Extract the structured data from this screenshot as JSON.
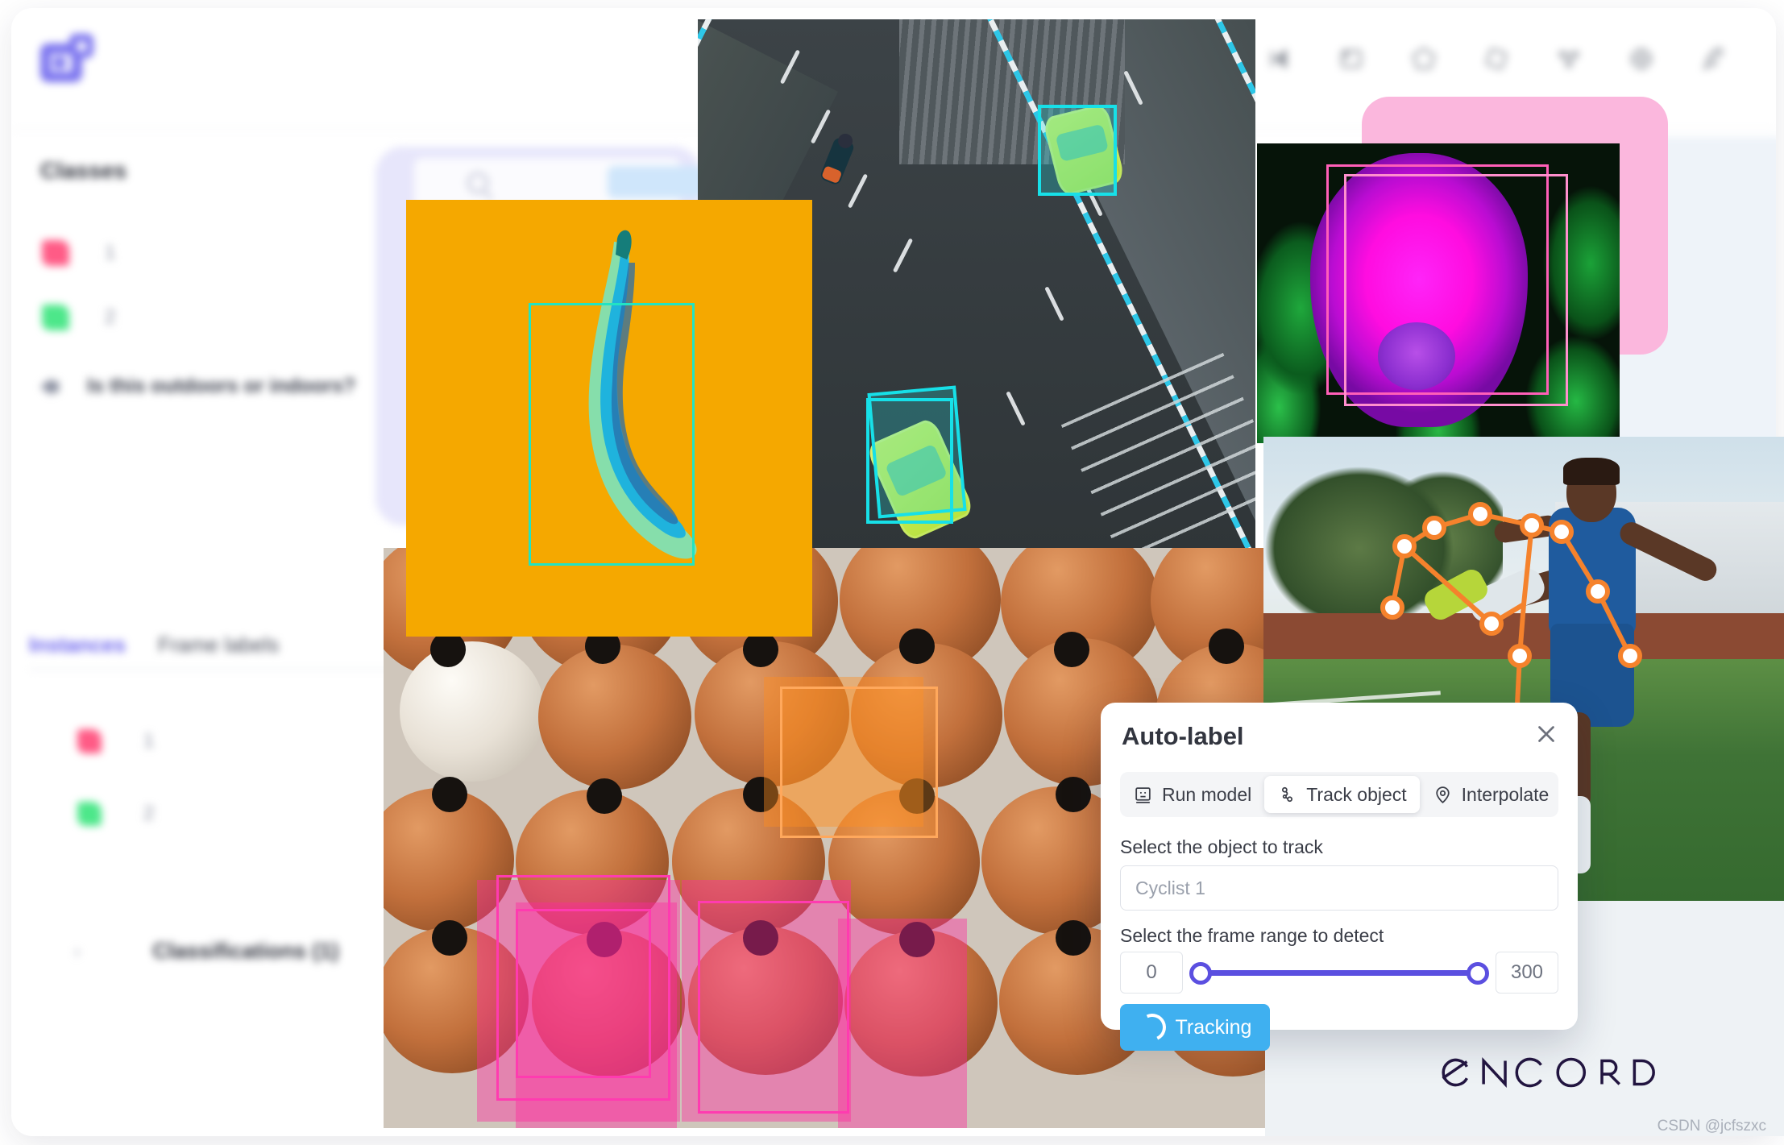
{
  "app": {
    "logo_icon": "encord-app-logo-icon",
    "toolbar_icons": [
      "previous-frame-icon",
      "bounding-box-icon",
      "polygon-icon",
      "rotate-bbox-icon",
      "keypoint-skeleton-icon",
      "polyline-icon",
      "magic-wand-icon"
    ]
  },
  "sidebar": {
    "classes_title": "Classes",
    "classes": [
      {
        "color": "#ff5b86",
        "count": "1"
      },
      {
        "color": "#4de78a",
        "count": "2"
      }
    ],
    "question": "Is this outdoors or indoors?",
    "tabs": [
      {
        "label": "Instances",
        "active": true
      },
      {
        "label": "Frame labels",
        "active": false
      }
    ],
    "instances": [
      {
        "color": "#ff5b86",
        "count": "1"
      },
      {
        "color": "#4de78a",
        "count": "2"
      }
    ],
    "classifications_label": "Classifications (1)",
    "chevron": "›"
  },
  "autolabel": {
    "title": "Auto-label",
    "close_icon": "close-icon",
    "tabs": [
      {
        "label": "Run model",
        "icon": "run-model-icon",
        "selected": false
      },
      {
        "label": "Track object",
        "icon": "track-object-icon",
        "selected": true
      },
      {
        "label": "Interpolate",
        "icon": "map-pin-icon",
        "selected": false
      }
    ],
    "object_label": "Select the object to track",
    "object_placeholder": "Cyclist 1",
    "range_label": "Select the frame range to detect",
    "range_min": "0",
    "range_max": "300",
    "submit_label": "Tracking",
    "submit_icon": "spinner-icon",
    "accent_blue": "#3fb0f0",
    "accent_purple": "#5b4fe0"
  },
  "branding": {
    "wordmark": "ENCORD",
    "watermark": "CSDN @jcfszxc"
  },
  "annotations": {
    "road": {
      "label_color": "#22e3c4",
      "objects": [
        "car",
        "car",
        "motorcycle"
      ]
    },
    "banana": {
      "label_color": "#22e3c4",
      "objects": [
        "banana"
      ]
    },
    "pepper": {
      "label_color": "#ff3bb0",
      "objects": [
        "pepper",
        "pepper"
      ]
    },
    "eggs": {
      "label_color_orange": "#ff8c1e",
      "label_color_pink": "#ff3bb0",
      "objects": [
        "egg",
        "egg",
        "egg",
        "egg"
      ]
    },
    "soccer": {
      "label_color": "#f5822c",
      "objects": [
        "person-pose"
      ]
    }
  }
}
